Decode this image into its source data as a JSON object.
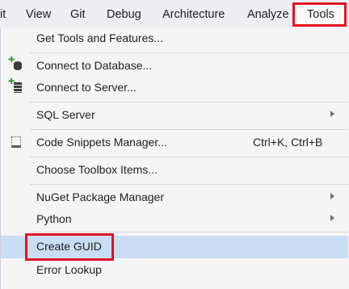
{
  "menubar": {
    "items": [
      "it",
      "View",
      "Git",
      "Debug",
      "Architecture",
      "Analyze",
      "Tools"
    ]
  },
  "tools_menu": {
    "get_tools": "Get Tools and Features...",
    "connect_db": "Connect to Database...",
    "connect_server": "Connect to Server...",
    "sql_server": "SQL Server",
    "snippets": "Code Snippets Manager...",
    "snippets_shortcut": "Ctrl+K, Ctrl+B",
    "toolbox_items": "Choose Toolbox Items...",
    "nuget": "NuGet Package Manager",
    "python": "Python",
    "create_guid": "Create GUID",
    "error_lookup": "Error Lookup"
  },
  "icons": {
    "connect_db": "database-add-icon",
    "connect_server": "server-add-icon",
    "snippets": "code-snippet-icon",
    "submenu": "chevron-right-icon"
  },
  "colors": {
    "highlight_border": "#e0141e",
    "selected_row": "#c9def5"
  }
}
